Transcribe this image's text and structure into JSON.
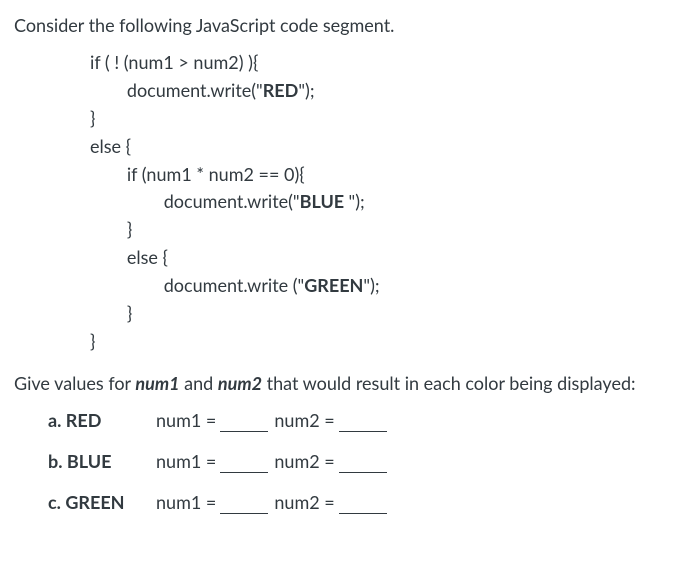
{
  "intro": "Consider the following JavaScript code segment.",
  "code": {
    "l1a": "if ( ! (num1 > num2) ){",
    "l2a": "        document.write(\"",
    "l2b": "RED",
    "l2c": "\");",
    "l3": "}",
    "l4": "else {",
    "l5": "        if (num1 * num2 == 0){",
    "l6a": "                document.write(\"",
    "l6b": "BLUE ",
    "l6c": "\");",
    "l7": "        }",
    "l8": "        else {",
    "l9a": "                document.write (\"",
    "l9b": "GREEN",
    "l9c": "\");",
    "l10": "        }",
    "l11": "}"
  },
  "prompt": {
    "pre": "Give values for ",
    "var1": "num1",
    "mid": " and ",
    "var2": "num2",
    "post": " that would result in each color being displayed:"
  },
  "answers": {
    "a": {
      "label": "a. RED"
    },
    "b": {
      "label": "b. BLUE"
    },
    "c": {
      "label": "c. GREEN"
    },
    "eq1": "num1 = ",
    "eq2": "num2 = "
  }
}
